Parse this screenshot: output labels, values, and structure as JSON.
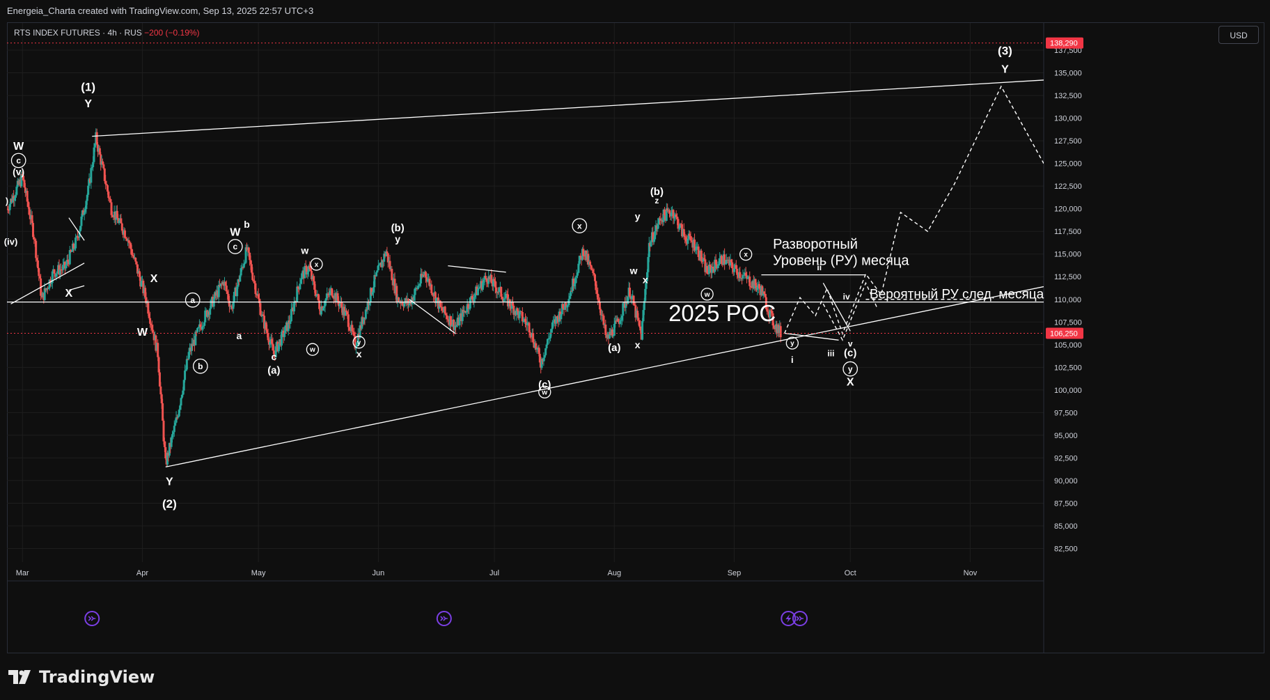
{
  "header": {
    "credit": "Energeia_Charta created with TradingView.com, Sep 13, 2025 22:57 UTC+3",
    "symbol": "RTS INDEX FUTURES · 4h · RUS",
    "change": "−200 (−0.19%)",
    "currency": "USD"
  },
  "brand": {
    "name": "TradingView",
    "logo_icon": "tradingview-logo-icon"
  },
  "colors": {
    "background": "#0f0f0f",
    "up": "#26a69a",
    "down": "#ef5350",
    "grid": "#1e1e1e",
    "text": "#d1d4dc",
    "white": "#ffffff",
    "last_price": "#f23645",
    "marker": "#7b3fe4"
  },
  "chart_data": {
    "type": "candlestick",
    "interval": "4h",
    "xlim": [
      "2025-02-25",
      "2025-11-20"
    ],
    "ylim": [
      81000,
      140500
    ],
    "x_ticks": [
      {
        "label": "Mar",
        "date": "2025-03-01"
      },
      {
        "label": "Apr",
        "date": "2025-04-01"
      },
      {
        "label": "May",
        "date": "2025-05-01"
      },
      {
        "label": "Jun",
        "date": "2025-06-01"
      },
      {
        "label": "Jul",
        "date": "2025-07-01"
      },
      {
        "label": "Aug",
        "date": "2025-08-01"
      },
      {
        "label": "Sep",
        "date": "2025-09-01"
      },
      {
        "label": "Oct",
        "date": "2025-10-01"
      },
      {
        "label": "Nov",
        "date": "2025-11-01"
      }
    ],
    "y_ticks": [
      "82,500",
      "85,000",
      "87,500",
      "90,000",
      "92,500",
      "95,000",
      "97,500",
      "100,000",
      "102,500",
      "105,000",
      "107,500",
      "110,000",
      "112,500",
      "115,000",
      "117,500",
      "120,000",
      "122,500",
      "125,000",
      "127,500",
      "130,000",
      "132,500",
      "135,000",
      "137,500"
    ],
    "price_labels": [
      {
        "value": 138290,
        "label": "138,290",
        "color": "#f23645",
        "line": "dotted"
      },
      {
        "value": 106250,
        "label": "106,250",
        "color": "#f23645",
        "line": "dotted"
      }
    ],
    "path_anchors": [
      [
        "2025-02-25",
        120000
      ],
      [
        "2025-03-01",
        123500
      ],
      [
        "2025-03-04",
        117000
      ],
      [
        "2025-03-06",
        110000
      ],
      [
        "2025-03-09",
        113000
      ],
      [
        "2025-03-12",
        113500
      ],
      [
        "2025-03-15",
        116500
      ],
      [
        "2025-03-18",
        122000
      ],
      [
        "2025-03-20",
        127800
      ],
      [
        "2025-03-24",
        120000
      ],
      [
        "2025-03-28",
        117000
      ],
      [
        "2025-04-02",
        110000
      ],
      [
        "2025-04-05",
        104000
      ],
      [
        "2025-04-07",
        91800
      ],
      [
        "2025-04-10",
        97000
      ],
      [
        "2025-04-13",
        104000
      ],
      [
        "2025-04-17",
        108000
      ],
      [
        "2025-04-22",
        112000
      ],
      [
        "2025-04-24",
        109000
      ],
      [
        "2025-04-28",
        115500
      ],
      [
        "2025-05-02",
        108000
      ],
      [
        "2025-05-05",
        104000
      ],
      [
        "2025-05-09",
        107500
      ],
      [
        "2025-05-12",
        112500
      ],
      [
        "2025-05-14",
        113500
      ],
      [
        "2025-05-17",
        109000
      ],
      [
        "2025-05-20",
        111000
      ],
      [
        "2025-05-24",
        108000
      ],
      [
        "2025-05-26",
        105000
      ],
      [
        "2025-05-31",
        112000
      ],
      [
        "2025-06-03",
        115300
      ],
      [
        "2025-06-06",
        110000
      ],
      [
        "2025-06-09",
        109500
      ],
      [
        "2025-06-13",
        113000
      ],
      [
        "2025-06-17",
        109000
      ],
      [
        "2025-06-21",
        107000
      ],
      [
        "2025-06-25",
        110000
      ],
      [
        "2025-06-29",
        112500
      ],
      [
        "2025-07-02",
        111000
      ],
      [
        "2025-07-06",
        109000
      ],
      [
        "2025-07-10",
        107000
      ],
      [
        "2025-07-13",
        103000
      ],
      [
        "2025-07-16",
        107000
      ],
      [
        "2025-07-20",
        110000
      ],
      [
        "2025-07-24",
        115500
      ],
      [
        "2025-07-27",
        112000
      ],
      [
        "2025-07-30",
        105500
      ],
      [
        "2025-08-02",
        107500
      ],
      [
        "2025-08-05",
        111000
      ],
      [
        "2025-08-08",
        106000
      ],
      [
        "2025-08-10",
        116000
      ],
      [
        "2025-08-13",
        119000
      ],
      [
        "2025-08-16",
        119800
      ],
      [
        "2025-08-19",
        117000
      ],
      [
        "2025-08-22",
        116000
      ],
      [
        "2025-08-25",
        113000
      ],
      [
        "2025-08-29",
        114500
      ],
      [
        "2025-09-02",
        113000
      ],
      [
        "2025-09-05",
        112000
      ],
      [
        "2025-09-08",
        111000
      ],
      [
        "2025-09-11",
        107500
      ],
      [
        "2025-09-13",
        106250
      ]
    ],
    "drawings": {
      "solid_lines": [
        [
          [
            "2025-03-19",
            128000
          ],
          [
            "2025-11-20",
            134200
          ]
        ],
        [
          [
            "2025-04-07",
            91500
          ],
          [
            "2025-11-20",
            111400
          ]
        ],
        [
          [
            "2025-02-25",
            109700
          ],
          [
            "2025-11-20",
            109700
          ]
        ],
        [
          [
            "2025-02-26",
            109500
          ],
          [
            "2025-03-17",
            114000
          ]
        ],
        [
          [
            "2025-03-13",
            119000
          ],
          [
            "2025-03-17",
            116500
          ]
        ],
        [
          [
            "2025-03-13",
            111000
          ],
          [
            "2025-03-17",
            111500
          ]
        ],
        [
          [
            "2025-06-09",
            110000
          ],
          [
            "2025-06-21",
            106200
          ]
        ],
        [
          [
            "2025-06-19",
            113700
          ],
          [
            "2025-07-04",
            113000
          ]
        ],
        [
          [
            "2025-09-08",
            112700
          ],
          [
            "2025-10-05",
            112700
          ]
        ],
        [
          [
            "2025-09-14",
            106250
          ],
          [
            "2025-09-28",
            105500
          ]
        ],
        [
          [
            "2025-09-24",
            111800
          ],
          [
            "2025-10-01",
            106500
          ]
        ]
      ],
      "dashed_path_1": [
        [
          "2025-09-14",
          106250
        ],
        [
          "2025-09-18",
          110200
        ],
        [
          "2025-09-22",
          108200
        ],
        [
          "2025-09-25",
          111200
        ],
        [
          "2025-09-29",
          106200
        ],
        [
          "2025-10-05",
          112800
        ],
        [
          "2025-10-09",
          110500
        ],
        [
          "2025-10-14",
          119600
        ],
        [
          "2025-10-21",
          117500
        ],
        [
          "2025-10-28",
          122800
        ],
        [
          "2025-11-09",
          133500
        ],
        [
          "2025-11-20",
          125000
        ]
      ],
      "dashed_path_2": [
        [
          "2025-09-24",
          109500
        ],
        [
          "2025-09-29",
          105500
        ],
        [
          "2025-10-05",
          111800
        ],
        [
          "2025-10-08",
          109000
        ]
      ],
      "dashed_flat": [
        [
          "2025-10-05",
          110000
        ],
        [
          "2025-11-05",
          110000
        ]
      ]
    },
    "labels": [
      {
        "text": "(1)",
        "date": "2025-03-18",
        "value": 133000,
        "size": 17
      },
      {
        "text": "Y",
        "date": "2025-03-18",
        "value": 131200,
        "size": 16
      },
      {
        "text": "W",
        "date": "2025-02-28",
        "value": 126500,
        "size": 16
      },
      {
        "text": "c",
        "date": "2025-02-28",
        "value": 125000,
        "size": 12,
        "circled": true
      },
      {
        "text": "(v)",
        "date": "2025-02-28",
        "value": 123700,
        "size": 14
      },
      {
        "text": "(iv)",
        "date": "2025-02-26",
        "value": 116000,
        "size": 13
      },
      {
        "text": ")",
        "date": "2025-02-25",
        "value": 120500,
        "size": 13
      },
      {
        "text": "X",
        "date": "2025-03-13",
        "value": 110300,
        "size": 16
      },
      {
        "text": "X",
        "date": "2025-04-04",
        "value": 111900,
        "size": 16
      },
      {
        "text": "W",
        "date": "2025-04-01",
        "value": 106000,
        "size": 16
      },
      {
        "text": "a",
        "date": "2025-04-14",
        "value": 109600,
        "size": 12,
        "circled": true
      },
      {
        "text": "b",
        "date": "2025-04-16",
        "value": 102300,
        "size": 12,
        "circled": true
      },
      {
        "text": "Y",
        "date": "2025-04-08",
        "value": 89500,
        "size": 16
      },
      {
        "text": "(2)",
        "date": "2025-04-08",
        "value": 87000,
        "size": 17
      },
      {
        "text": "W",
        "date": "2025-04-25",
        "value": 117000,
        "size": 16
      },
      {
        "text": "c",
        "date": "2025-04-25",
        "value": 115500,
        "size": 12,
        "circled": true
      },
      {
        "text": "b",
        "date": "2025-04-28",
        "value": 117900,
        "size": 14
      },
      {
        "text": "a",
        "date": "2025-04-26",
        "value": 105600,
        "size": 14
      },
      {
        "text": "c",
        "date": "2025-05-05",
        "value": 103300,
        "size": 14
      },
      {
        "text": "(a)",
        "date": "2025-05-05",
        "value": 101800,
        "size": 15
      },
      {
        "text": "w",
        "date": "2025-05-13",
        "value": 115000,
        "size": 14
      },
      {
        "text": "x",
        "date": "2025-05-16",
        "value": 113600,
        "size": 10,
        "circled": true
      },
      {
        "text": "w",
        "date": "2025-05-15",
        "value": 104200,
        "size": 10,
        "circled": true
      },
      {
        "text": "y",
        "date": "2025-05-27",
        "value": 105000,
        "size": 10,
        "circled": true
      },
      {
        "text": "x",
        "date": "2025-05-27",
        "value": 103600,
        "size": 14
      },
      {
        "text": "(b)",
        "date": "2025-06-06",
        "value": 117500,
        "size": 15
      },
      {
        "text": "y",
        "date": "2025-06-06",
        "value": 116300,
        "size": 14
      },
      {
        "text": "(c)",
        "date": "2025-07-14",
        "value": 100200,
        "size": 15
      },
      {
        "text": "w",
        "date": "2025-07-14",
        "value": 99500,
        "size": 10,
        "circled": true
      },
      {
        "text": "x",
        "date": "2025-07-23",
        "value": 117800,
        "size": 12,
        "circled": true
      },
      {
        "text": "(a)",
        "date": "2025-08-01",
        "value": 104300,
        "size": 15
      },
      {
        "text": "y",
        "date": "2025-08-07",
        "value": 118800,
        "size": 14
      },
      {
        "text": "w",
        "date": "2025-08-06",
        "value": 112800,
        "size": 14
      },
      {
        "text": "x",
        "date": "2025-08-09",
        "value": 111800,
        "size": 14
      },
      {
        "text": "x",
        "date": "2025-08-07",
        "value": 104600,
        "size": 14
      },
      {
        "text": "(b)",
        "date": "2025-08-12",
        "value": 121500,
        "size": 15
      },
      {
        "text": "z",
        "date": "2025-08-12",
        "value": 120600,
        "size": 12
      },
      {
        "text": "x",
        "date": "2025-09-04",
        "value": 114700,
        "size": 10,
        "circled": true
      },
      {
        "text": "w",
        "date": "2025-08-25",
        "value": 110300,
        "size": 10,
        "circled": true
      },
      {
        "text": "y",
        "date": "2025-09-16",
        "value": 104900,
        "size": 10,
        "circled": true
      },
      {
        "text": "i",
        "date": "2025-09-16",
        "value": 103000,
        "size": 13
      },
      {
        "text": "ii",
        "date": "2025-09-23",
        "value": 113200,
        "size": 12
      },
      {
        "text": "iii",
        "date": "2025-09-26",
        "value": 103700,
        "size": 12
      },
      {
        "text": "iv",
        "date": "2025-09-30",
        "value": 110000,
        "size": 12
      },
      {
        "text": "v",
        "date": "2025-10-01",
        "value": 104800,
        "size": 12
      },
      {
        "text": "(c)",
        "date": "2025-10-01",
        "value": 103700,
        "size": 15
      },
      {
        "text": "y",
        "date": "2025-10-01",
        "value": 102000,
        "size": 12,
        "circled": true
      },
      {
        "text": "X",
        "date": "2025-10-01",
        "value": 100500,
        "size": 16
      },
      {
        "text": "(3)",
        "date": "2025-11-10",
        "value": 137000,
        "size": 17
      },
      {
        "text": "Y",
        "date": "2025-11-10",
        "value": 135000,
        "size": 16
      }
    ],
    "annotations": [
      {
        "text": "Разворотный",
        "date": "2025-09-11",
        "value": 115600,
        "size": 20
      },
      {
        "text": "Уровень (РУ) месяца",
        "date": "2025-09-11",
        "value": 113800,
        "size": 20
      },
      {
        "text": "Вероятный РУ след. месяца",
        "date": "2025-10-06",
        "value": 110100,
        "size": 19
      },
      {
        "text": "2025 POC",
        "date": "2025-08-15",
        "value": 107600,
        "size": 33
      }
    ],
    "event_markers": [
      {
        "date": "2025-03-19",
        "icon": "forward-arrow-icon"
      },
      {
        "date": "2025-06-18",
        "icon": "forward-arrow-icon"
      },
      {
        "date": "2025-09-15",
        "icon": "lightning-icon"
      },
      {
        "date": "2025-09-18",
        "icon": "forward-arrow-icon"
      }
    ]
  }
}
